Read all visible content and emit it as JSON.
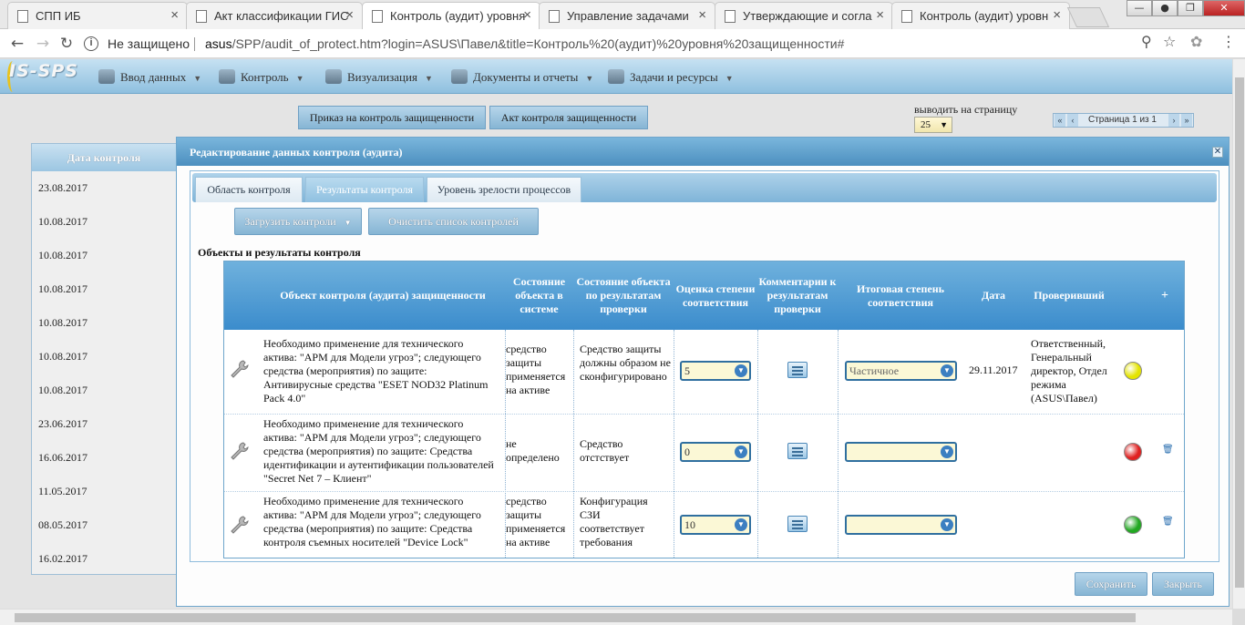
{
  "browser": {
    "tabs": [
      {
        "title": "СПП ИБ"
      },
      {
        "title": "Акт классификации ГИС"
      },
      {
        "title": "Контроль (аудит) уровня"
      },
      {
        "title": "Управление задачами"
      },
      {
        "title": "Утверждающие и согла"
      },
      {
        "title": "Контроль (аудит) уровн"
      }
    ],
    "security_label": "Не защищено",
    "url_host": "asus",
    "url_path": "/SPP/audit_of_protect.htm?login=ASUS\\Павел&title=Контроль%20(аудит)%20уровня%20защищенности#"
  },
  "app": {
    "logo": "IS-SPS",
    "menu": [
      {
        "label": "Ввод данных"
      },
      {
        "label": "Контроль"
      },
      {
        "label": "Визуализация"
      },
      {
        "label": "Документы и отчеты"
      },
      {
        "label": "Задачи и ресурсы"
      }
    ]
  },
  "page": {
    "btn_order": "Приказ на контроль защищенности",
    "btn_act": "Акт контроля защищенности",
    "per_page_label": "выводить на страницу",
    "per_page_value": "25",
    "pager_text": "Страница 1 из 1",
    "date_header": "Дата контроля",
    "dates": [
      "23.08.2017",
      "10.08.2017",
      "10.08.2017",
      "10.08.2017",
      "10.08.2017",
      "10.08.2017",
      "10.08.2017",
      "23.06.2017",
      "16.06.2017",
      "11.05.2017",
      "08.05.2017",
      "16.02.2017"
    ]
  },
  "modal": {
    "title": "Редактирование данных контроля (аудита)",
    "tabs": [
      "Область контроля",
      "Результаты контроля",
      "Уровень зрелости процессов"
    ],
    "active_tab": 1,
    "btn_load": "Загрузить контроли",
    "btn_clear": "Очистить список контролей",
    "section_title": "Объекты и результаты контроля",
    "columns": {
      "object": "Объект контроля (аудита) защищенности",
      "state_system": "Состояние объекта в системе",
      "state_check": "Состояние объекта по результатам проверки",
      "score": "Оценка степени соответствия",
      "comments": "Комментарии к результатам проверки",
      "final": "Итоговая степень соответствия",
      "date": "Дата",
      "checker": "Проверивший",
      "add": "+"
    },
    "rows": [
      {
        "object": "Необходимо применение для технического актива: \"АРМ для Модели угроз\"; следующего средства (мероприятия) по защите: Антивирусные средства \"ESET NOD32 Platinum Pack 4.0\"",
        "state_system": "средство защиты применяется на активе",
        "state_check": "Средство защиты должны образом не сконфигурировано",
        "score": "5",
        "final": "Частичное",
        "date": "29.11.2017",
        "checker": "Ответственный, Генеральный директор, Отдел режима (ASUS\\Павел)",
        "status_color": "#e4e400"
      },
      {
        "object": "Необходимо применение для технического актива: \"АРМ для Модели угроз\"; следующего средства (мероприятия) по защите: Средства идентификации и аутентификации пользователей \"Secret Net 7 – Клиент\"",
        "state_system": "не определено",
        "state_check": "Средство отстствует",
        "score": "0",
        "final": "",
        "date": "",
        "checker": "",
        "status_color": "#e02020"
      },
      {
        "object": "Необходимо применение для технического актива: \"АРМ для Модели угроз\"; следующего средства (мероприятия) по защите: Средства контроля съемных носителей \"Device Lock\"",
        "state_system": "средство защиты применяется на активе",
        "state_check": "Конфигурация СЗИ соответствует требования",
        "score": "10",
        "final": "",
        "date": "",
        "checker": "",
        "status_color": "#22a822"
      }
    ],
    "btn_save": "Сохранить",
    "btn_close": "Закрыть"
  }
}
